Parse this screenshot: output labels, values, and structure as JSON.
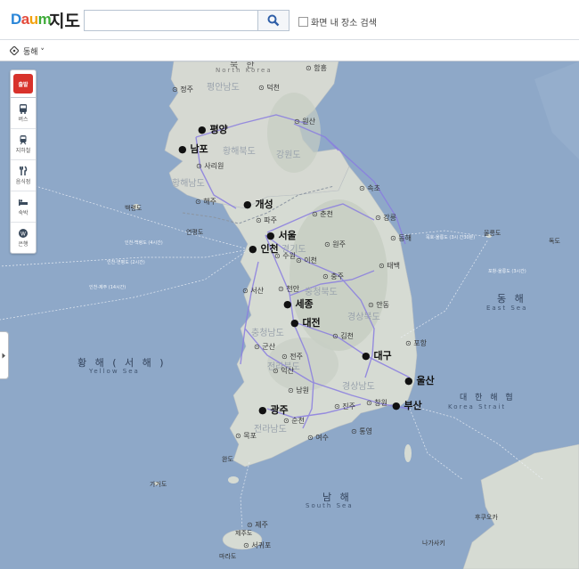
{
  "header": {
    "logo_letters": [
      "D",
      "a",
      "u",
      "m"
    ],
    "title": "지도",
    "search_placeholder": "",
    "search_button_icon": "search-icon",
    "checkbox_label": "화면 내 장소 검색"
  },
  "subbar": {
    "location_label": "동해 ˅"
  },
  "toolbar": {
    "top_label": "출발",
    "items": [
      {
        "icon": "bus-icon",
        "label": "버스"
      },
      {
        "icon": "subway-icon",
        "label": "지하철"
      },
      {
        "icon": "restaurant-icon",
        "label": "음식점"
      },
      {
        "icon": "bed-icon",
        "label": "숙박"
      },
      {
        "icon": "bank-icon",
        "label": "은행"
      }
    ]
  },
  "map": {
    "seas": {
      "west_ko": "황 해 ( 서 해 )",
      "west_en": "Yellow Sea",
      "east_ko": "동 해",
      "east_en": "East Sea",
      "south_ko": "남 해",
      "south_en": "South Sea",
      "strait_ko": "대 한 해 협",
      "strait_en": "Korea Strait",
      "north_ko": "북 한",
      "north_en": "North Korea"
    },
    "major_cities": [
      "평양",
      "남포",
      "개성",
      "서울",
      "인천",
      "세종",
      "대전",
      "대구",
      "울산",
      "광주",
      "부산"
    ],
    "cities": [
      "정주",
      "덕천",
      "함흥",
      "원산",
      "사리원",
      "해주",
      "파주",
      "춘천",
      "속초",
      "강릉",
      "동해",
      "수원",
      "이천",
      "원주",
      "충주",
      "태백",
      "서산",
      "천안",
      "안동",
      "포항",
      "군산",
      "전주",
      "김천",
      "익산",
      "남원",
      "진주",
      "창원",
      "목포",
      "순천",
      "여수",
      "통영",
      "제주",
      "서귀포",
      "백령도",
      "연평도",
      "가거도",
      "완도"
    ],
    "provinces": [
      "평안남도",
      "황해북도",
      "황해남도",
      "강원도",
      "경기도",
      "충청북도",
      "충청남도",
      "경상북도",
      "전라북도",
      "경상남도",
      "전라남도"
    ],
    "other_labels": [
      "강릉",
      "울릉도",
      "독도",
      "후쿠오카",
      "나가사키",
      "마라도",
      "제주도"
    ],
    "ferry_routes": [
      "묵호-울릉도 (3시 간30분)",
      "인천-백령도 (4시간)",
      "인천-연평도 (2시간)",
      "인천-제주 (14시간)",
      "포항-울릉도 (3시간)"
    ],
    "colors": {
      "sea": "#8ea8c8",
      "land": "#d6dbd3",
      "road": "#8a7ee0",
      "major_dot": "#e8c21a"
    }
  }
}
